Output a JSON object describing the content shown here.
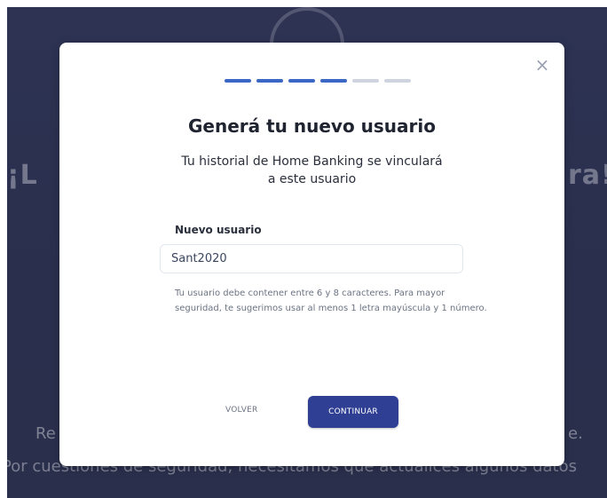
{
  "background": {
    "left_headline_fragment": "¡L",
    "right_headline_fragment": "ra!",
    "left_mid_fragment": "Re",
    "right_mid_fragment": "e.",
    "bottom_line": "Por cuestiones de seguridad, necesitamos que actualices algunos datos"
  },
  "modal": {
    "close_symbol": "×",
    "stepper": {
      "total": 6,
      "completed": 4
    },
    "title": "Generá tu nuevo usuario",
    "subtitle_line1": "Tu historial de Home Banking se vinculará",
    "subtitle_line2": "a este usuario",
    "field": {
      "label": "Nuevo usuario",
      "value": "Sant2020"
    },
    "helper_line1": "Tu usuario debe contener entre 6 y 8 caracteres. Para mayor",
    "helper_line2": "seguridad, te sugerimos usar al menos 1 letra mayúscula y 1 número.",
    "actions": {
      "back_label": "VOLVER",
      "continue_label": "CONTINUAR"
    }
  },
  "colors": {
    "backdrop": "#2e3354",
    "primary": "#2f3f93",
    "step_done": "#3b68c6",
    "step_todo": "#cfd5df"
  }
}
